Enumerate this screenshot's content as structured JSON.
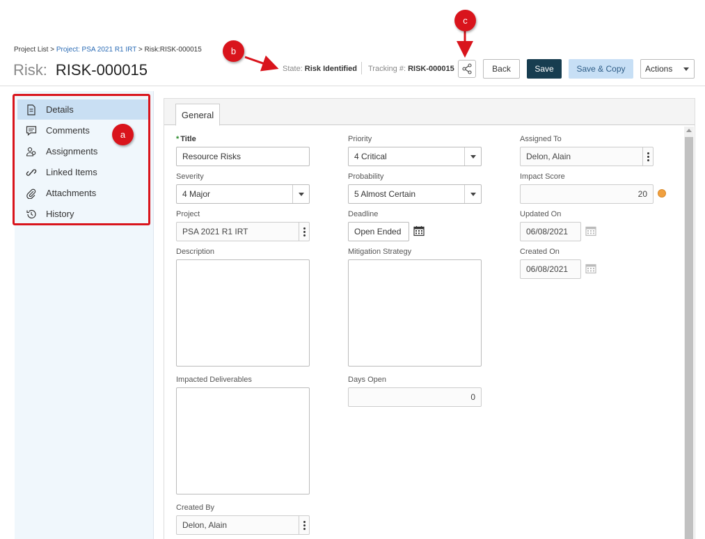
{
  "header": {
    "breadcrumb": {
      "root": "Project List",
      "sep1": " > ",
      "project_link": "Project: PSA 2021 R1 IRT",
      "sep2": " > ",
      "current": "Risk:RISK-000015"
    },
    "title_prefix": "Risk:",
    "title_id": "RISK-000015",
    "state_label": "State: ",
    "state_value": "Risk Identified",
    "tracking_label": "Tracking #: ",
    "tracking_value": "RISK-000015",
    "buttons": {
      "back": "Back",
      "save": "Save",
      "save_copy": "Save & Copy",
      "actions": "Actions"
    }
  },
  "sidebar": {
    "items": [
      {
        "label": "Details",
        "icon": "document-icon",
        "active": true
      },
      {
        "label": "Comments",
        "icon": "comment-icon",
        "active": false
      },
      {
        "label": "Assignments",
        "icon": "users-icon",
        "active": false
      },
      {
        "label": "Linked Items",
        "icon": "link-icon",
        "active": false
      },
      {
        "label": "Attachments",
        "icon": "paperclip-icon",
        "active": false
      },
      {
        "label": "History",
        "icon": "history-icon",
        "active": false
      }
    ]
  },
  "tabs": {
    "general": "General"
  },
  "form": {
    "title": {
      "label": "Title",
      "value": "Resource Risks"
    },
    "priority": {
      "label": "Priority",
      "value": "4 Critical"
    },
    "assigned_to": {
      "label": "Assigned To",
      "value": "Delon, Alain"
    },
    "severity": {
      "label": "Severity",
      "value": "4 Major"
    },
    "probability": {
      "label": "Probability",
      "value": "5 Almost Certain"
    },
    "impact_score": {
      "label": "Impact Score",
      "value": "20"
    },
    "project": {
      "label": "Project",
      "value": "PSA 2021 R1 IRT"
    },
    "deadline": {
      "label": "Deadline",
      "value": "Open Ended"
    },
    "updated_on": {
      "label": "Updated On",
      "value": "06/08/2021"
    },
    "description": {
      "label": "Description",
      "value": ""
    },
    "mitigation_strategy": {
      "label": "Mitigation Strategy",
      "value": ""
    },
    "created_on": {
      "label": "Created On",
      "value": "06/08/2021"
    },
    "impacted_deliverables": {
      "label": "Impacted Deliverables",
      "value": ""
    },
    "days_open": {
      "label": "Days Open",
      "value": "0"
    },
    "created_by": {
      "label": "Created By",
      "value": "Delon, Alain"
    },
    "required_marker": "*"
  },
  "callouts": {
    "a": "a",
    "b": "b",
    "c": "c"
  },
  "colors": {
    "callout_red": "#d9141c",
    "save_button": "#173d50",
    "save_copy_button": "#c7dff5",
    "sidebar_bg": "#f0f7fc",
    "sidebar_active": "#c9dff3",
    "impact_dot": "#f0a040"
  }
}
